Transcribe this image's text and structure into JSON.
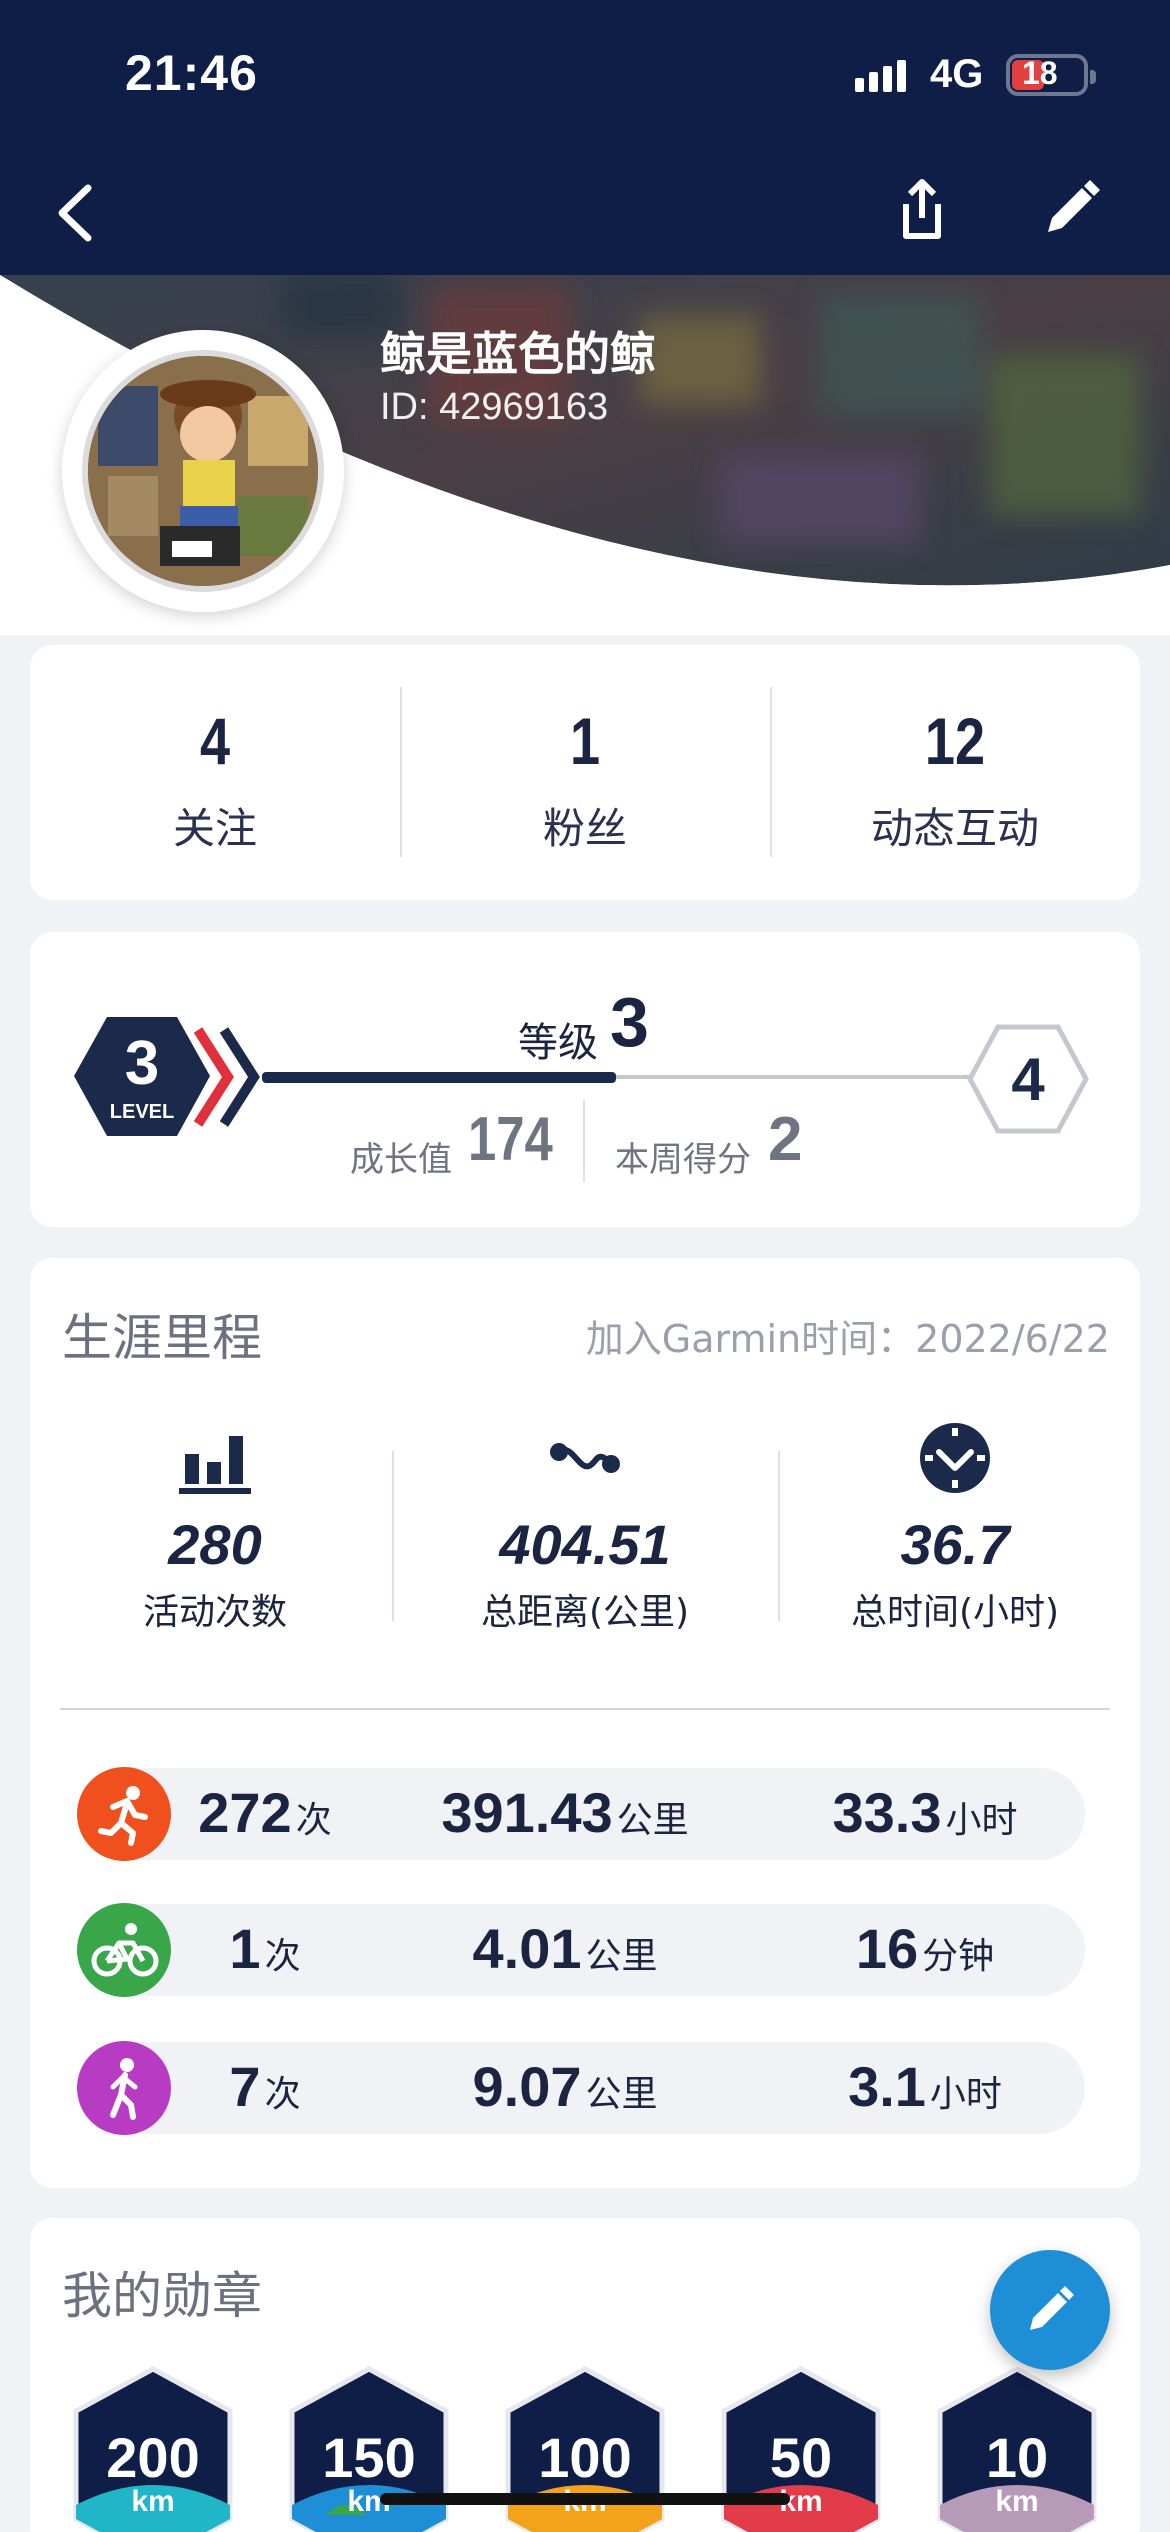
{
  "status_bar": {
    "time": "21:46",
    "network": "4G",
    "battery": "18"
  },
  "profile": {
    "name": "鲸是蓝色的鲸",
    "id": "ID: 42969163"
  },
  "social": [
    {
      "value": "4",
      "label": "关注"
    },
    {
      "value": "1",
      "label": "粉丝"
    },
    {
      "value": "12",
      "label": "动态互动"
    }
  ],
  "level": {
    "current_badge": "3",
    "current_badge_caption": "LEVEL",
    "next_badge": "4",
    "title_label": "等级",
    "title_value": "3",
    "progress": 0.48,
    "growth_label": "成长值",
    "growth_value": "174",
    "weekly_label": "本周得分",
    "weekly_value": "2"
  },
  "career": {
    "title": "生涯里程",
    "join_text": "加入Garmin时间：2022/6/22",
    "stats": [
      {
        "icon": "bar-chart-icon",
        "value": "280",
        "label": "活动次数"
      },
      {
        "icon": "route-icon",
        "value": "404.51",
        "label": "总距离(公里)"
      },
      {
        "icon": "clock-icon",
        "value": "36.7",
        "label": "总时间(小时)"
      }
    ],
    "sports": [
      {
        "icon": "running-icon",
        "color": "#f0501e",
        "count": "272",
        "count_unit": "次",
        "distance": "391.43",
        "distance_unit": "公里",
        "time": "33.3",
        "time_unit": "小时"
      },
      {
        "icon": "cycling-icon",
        "color": "#3aa64a",
        "count": "1",
        "count_unit": "次",
        "distance": "4.01",
        "distance_unit": "公里",
        "time": "16",
        "time_unit": "分钟"
      },
      {
        "icon": "walking-icon",
        "color": "#b83bc4",
        "count": "7",
        "count_unit": "次",
        "distance": "9.07",
        "distance_unit": "公里",
        "time": "3.1",
        "time_unit": "小时"
      }
    ]
  },
  "medals": {
    "title": "我的勋章",
    "items": [
      {
        "distance": "200",
        "unit": "km",
        "color": "#21b5c8"
      },
      {
        "distance": "150",
        "unit": "km",
        "color": "#1e8ed6"
      },
      {
        "distance": "100",
        "unit": "km",
        "color": "#f2a319"
      },
      {
        "distance": "50",
        "unit": "km",
        "color": "#e23b4a"
      },
      {
        "distance": "10",
        "unit": "km",
        "color": "#b79ab8"
      }
    ]
  },
  "colors": {
    "navy": "#0f1e47",
    "accent": "#1e8ed6"
  }
}
